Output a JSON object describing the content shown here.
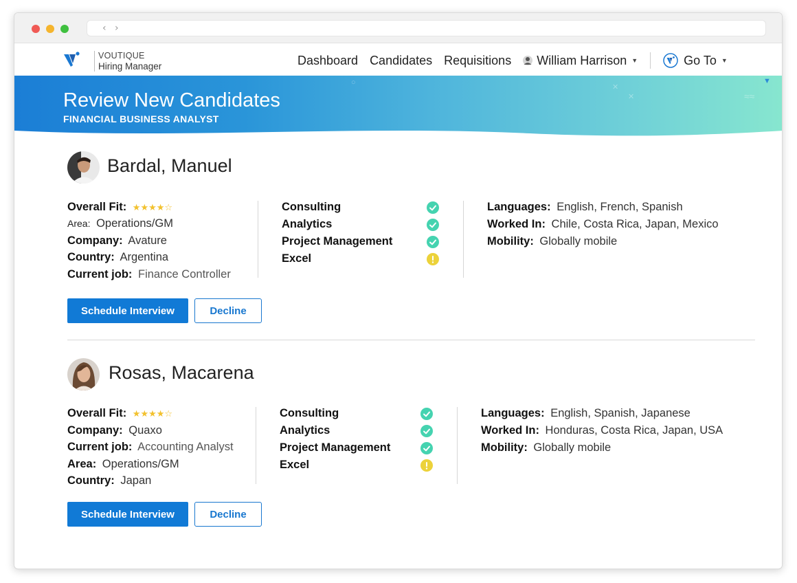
{
  "app": {
    "brand_name": "VOUTIQUE",
    "brand_role": "Hiring Manager"
  },
  "nav": {
    "links": [
      "Dashboard",
      "Candidates",
      "Requisitions"
    ],
    "user_name": "William Harrison",
    "goto_label": "Go To"
  },
  "banner": {
    "title": "Review New Candidates",
    "subtitle": "FINANCIAL BUSINESS ANALYST"
  },
  "labels": {
    "overall_fit": "Overall Fit:",
    "area": "Area:",
    "company": "Company:",
    "country": "Country:",
    "current_job": "Current job:",
    "languages": "Languages:",
    "worked_in": "Worked In:",
    "mobility": "Mobility:",
    "schedule_button": "Schedule Interview",
    "decline_button": "Decline"
  },
  "candidates": [
    {
      "name": "Bardal, Manuel",
      "rating": 4,
      "rating_max": 5,
      "stars_text": "★★★★☆",
      "area": "Operations/GM",
      "company": "Avature",
      "country": "Argentina",
      "current_job": "Finance Controller",
      "skills": [
        {
          "name": "Consulting",
          "status": "match"
        },
        {
          "name": "Analytics",
          "status": "match"
        },
        {
          "name": "Project Management",
          "status": "match"
        },
        {
          "name": "Excel",
          "status": "warning"
        }
      ],
      "languages": "English, French, Spanish",
      "worked_in": "Chile, Costa Rica, Japan, Mexico",
      "mobility": "Globally mobile"
    },
    {
      "name": "Rosas, Macarena",
      "rating": 4,
      "rating_max": 5,
      "stars_text": "★★★★☆",
      "company": "Quaxo",
      "current_job": "Accounting Analyst",
      "area": "Operations/GM",
      "country": "Japan",
      "skills": [
        {
          "name": "Consulting",
          "status": "match"
        },
        {
          "name": "Analytics",
          "status": "match"
        },
        {
          "name": "Project Management",
          "status": "match"
        },
        {
          "name": "Excel",
          "status": "warning"
        }
      ],
      "languages": "English, Spanish, Japanese",
      "worked_in": "Honduras, Costa Rica, Japan, USA",
      "mobility": "Globally mobile"
    }
  ],
  "colors": {
    "primary": "#117ad6",
    "match": "#45d3b0",
    "warning": "#ecd23a",
    "star": "#f2c12e"
  }
}
